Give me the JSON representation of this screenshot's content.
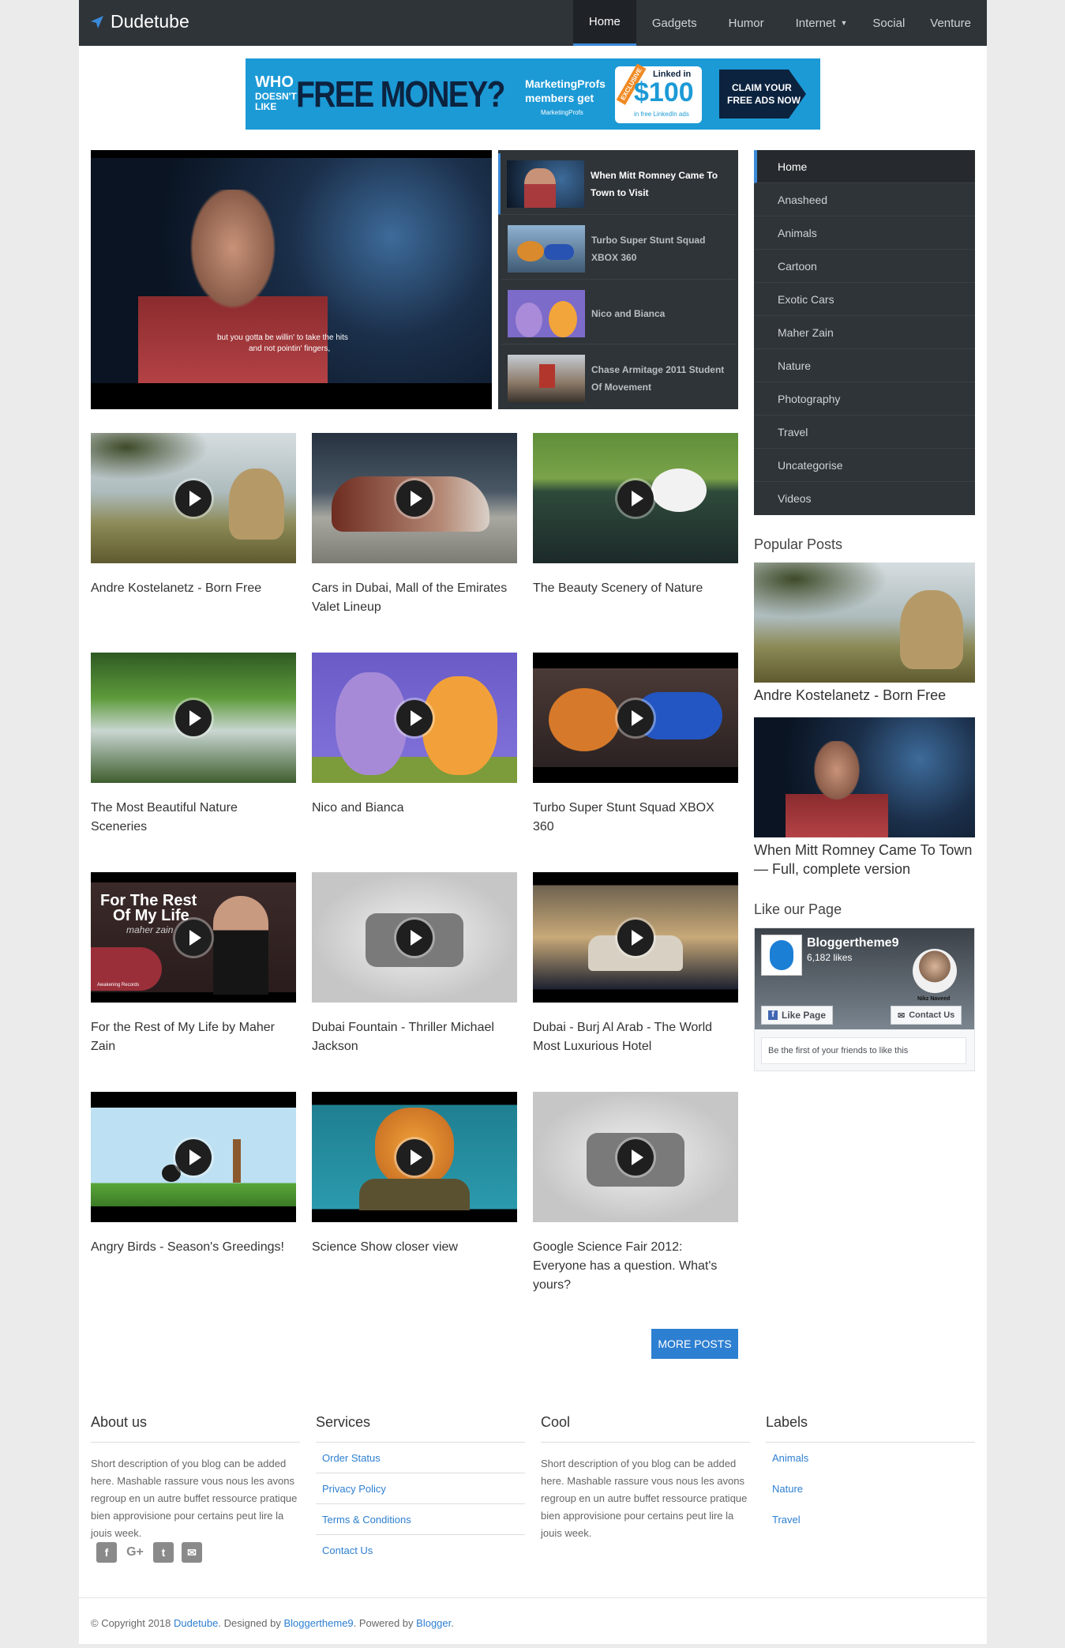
{
  "header": {
    "site_name": "Dudetube",
    "nav": [
      "Home",
      "Gadgets",
      "Humor",
      "Internet",
      "Social",
      "Venture"
    ]
  },
  "banner": {
    "who": "WHO",
    "doesnt_like": "DOESN'T LIKE",
    "headline": "FREE MONEY?",
    "sub1": "MarketingProfs",
    "sub2": "members get",
    "brand": "MarketingProfs",
    "exclusive": "EXCLUSIVE",
    "linkedin": "Linked in",
    "amount": "$100",
    "amount_sub": "in free LinkedIn ads",
    "cta1": "CLAIM YOUR",
    "cta2": "FREE ADS NOW"
  },
  "featured": {
    "subtitle1": "but you gotta be willin' to take the hits",
    "subtitle2": "and not pointin' fingers,",
    "items": [
      "When Mitt Romney Came To Town to Visit",
      "Turbo Super Stunt Squad XBOX 360",
      "Nico and Bianca",
      "Chase Armitage 2011 Student Of Movement"
    ]
  },
  "posts": [
    "Andre Kostelanetz - Born Free",
    "Cars in Dubai, Mall of the Emirates Valet Lineup",
    "The Beauty Scenery of Nature",
    "The Most Beautiful Nature Sceneries",
    "Nico and Bianca",
    "Turbo Super Stunt Squad XBOX 360",
    "For the Rest of My Life by Maher Zain",
    "Dubai Fountain - Thriller Michael Jackson",
    "Dubai - Burj Al Arab - The World Most Luxurious Hotel",
    "Angry Birds - Season's Greedings!",
    "Science Show closer view",
    "Google Science Fair 2012: Everyone has a question. What's yours?"
  ],
  "thumb_text": {
    "rest1": "For The Rest",
    "rest2": "Of My Life",
    "rest3": "maher zain",
    "rest4": "Awakening Records"
  },
  "more_posts_label": "MORE POSTS",
  "sidebar": {
    "menu": [
      "Home",
      "Anasheed",
      "Animals",
      "Cartoon",
      "Exotic Cars",
      "Maher Zain",
      "Nature",
      "Photography",
      "Travel",
      "Uncategorise",
      "Videos"
    ],
    "popular_heading": "Popular Posts",
    "popular": [
      "Andre Kostelanetz - Born Free",
      "When Mitt Romney Came To Town — Full, complete version"
    ],
    "like_heading": "Like our Page",
    "fb": {
      "page_name": "Bloggertheme9",
      "likes": "6,182 likes",
      "profile_name": "Nikz Naveed",
      "like_btn": "Like Page",
      "contact_btn": "Contact Us",
      "friends": "Be the first of your friends to like this"
    }
  },
  "footer": {
    "about": {
      "heading": "About us",
      "text": "Short description of you blog can be added here. Mashable rassure vous nous les avons regroup en un autre buffet ressource pratique bien approvisione pour certains peut lire la jouis week."
    },
    "services": {
      "heading": "Services",
      "links": [
        "Order Status",
        "Privacy Policy",
        "Terms & Conditions",
        "Contact Us"
      ]
    },
    "cool": {
      "heading": "Cool",
      "text": "Short description of you blog can be added here. Mashable rassure vous nous les avons regroup en un autre buffet ressource pratique bien approvisione pour certains peut lire la jouis week."
    },
    "labels": {
      "heading": "Labels",
      "links": [
        "Animals",
        "Nature",
        "Travel"
      ]
    },
    "social": [
      "f",
      "G+",
      "t",
      "✉"
    ],
    "copyright": {
      "prefix": "© Copyright 2018 ",
      "site": "Dudetube",
      "designed": ". Designed by ",
      "designer": "Bloggertheme9",
      "powered": ". Powered by ",
      "platform": "Blogger",
      "end": "."
    }
  },
  "colors": {
    "accent": "#2d7fd1",
    "nav_bg": "#2f3439",
    "nav_active": "#1f2327"
  }
}
